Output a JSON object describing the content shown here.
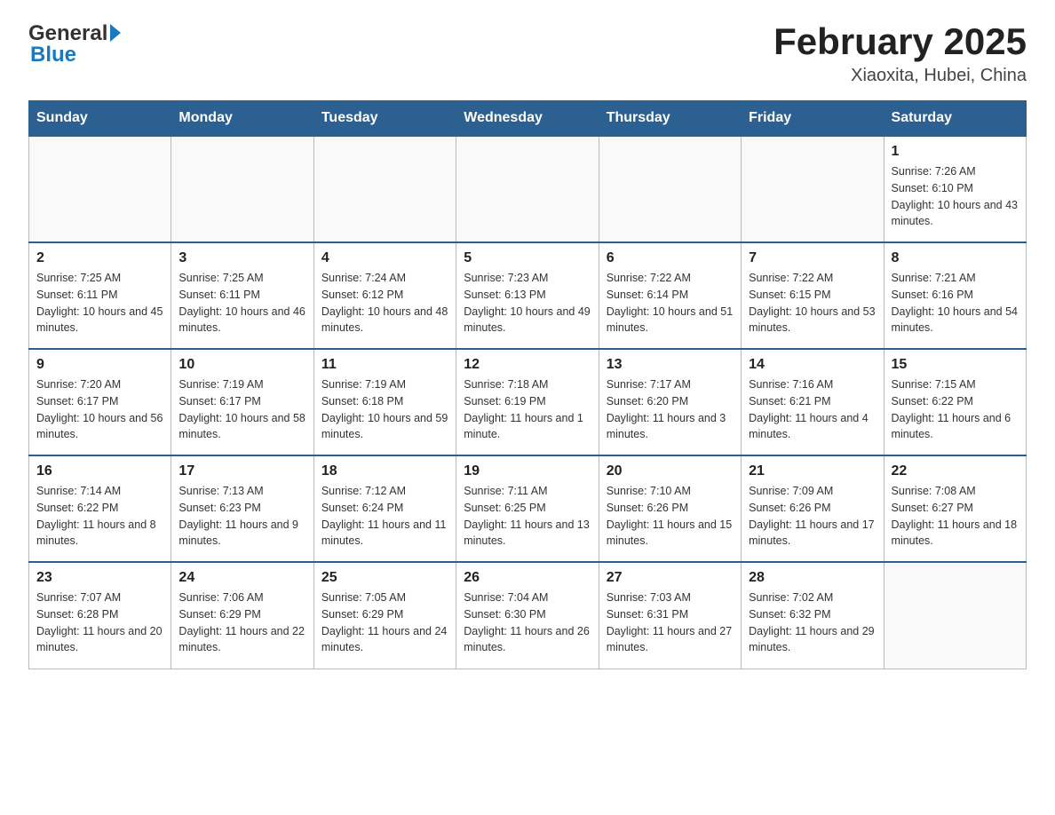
{
  "logo": {
    "general": "General",
    "blue": "Blue"
  },
  "header": {
    "month_year": "February 2025",
    "location": "Xiaoxita, Hubei, China"
  },
  "weekdays": [
    "Sunday",
    "Monday",
    "Tuesday",
    "Wednesday",
    "Thursday",
    "Friday",
    "Saturday"
  ],
  "weeks": [
    [
      {
        "day": "",
        "info": ""
      },
      {
        "day": "",
        "info": ""
      },
      {
        "day": "",
        "info": ""
      },
      {
        "day": "",
        "info": ""
      },
      {
        "day": "",
        "info": ""
      },
      {
        "day": "",
        "info": ""
      },
      {
        "day": "1",
        "info": "Sunrise: 7:26 AM\nSunset: 6:10 PM\nDaylight: 10 hours and 43 minutes."
      }
    ],
    [
      {
        "day": "2",
        "info": "Sunrise: 7:25 AM\nSunset: 6:11 PM\nDaylight: 10 hours and 45 minutes."
      },
      {
        "day": "3",
        "info": "Sunrise: 7:25 AM\nSunset: 6:11 PM\nDaylight: 10 hours and 46 minutes."
      },
      {
        "day": "4",
        "info": "Sunrise: 7:24 AM\nSunset: 6:12 PM\nDaylight: 10 hours and 48 minutes."
      },
      {
        "day": "5",
        "info": "Sunrise: 7:23 AM\nSunset: 6:13 PM\nDaylight: 10 hours and 49 minutes."
      },
      {
        "day": "6",
        "info": "Sunrise: 7:22 AM\nSunset: 6:14 PM\nDaylight: 10 hours and 51 minutes."
      },
      {
        "day": "7",
        "info": "Sunrise: 7:22 AM\nSunset: 6:15 PM\nDaylight: 10 hours and 53 minutes."
      },
      {
        "day": "8",
        "info": "Sunrise: 7:21 AM\nSunset: 6:16 PM\nDaylight: 10 hours and 54 minutes."
      }
    ],
    [
      {
        "day": "9",
        "info": "Sunrise: 7:20 AM\nSunset: 6:17 PM\nDaylight: 10 hours and 56 minutes."
      },
      {
        "day": "10",
        "info": "Sunrise: 7:19 AM\nSunset: 6:17 PM\nDaylight: 10 hours and 58 minutes."
      },
      {
        "day": "11",
        "info": "Sunrise: 7:19 AM\nSunset: 6:18 PM\nDaylight: 10 hours and 59 minutes."
      },
      {
        "day": "12",
        "info": "Sunrise: 7:18 AM\nSunset: 6:19 PM\nDaylight: 11 hours and 1 minute."
      },
      {
        "day": "13",
        "info": "Sunrise: 7:17 AM\nSunset: 6:20 PM\nDaylight: 11 hours and 3 minutes."
      },
      {
        "day": "14",
        "info": "Sunrise: 7:16 AM\nSunset: 6:21 PM\nDaylight: 11 hours and 4 minutes."
      },
      {
        "day": "15",
        "info": "Sunrise: 7:15 AM\nSunset: 6:22 PM\nDaylight: 11 hours and 6 minutes."
      }
    ],
    [
      {
        "day": "16",
        "info": "Sunrise: 7:14 AM\nSunset: 6:22 PM\nDaylight: 11 hours and 8 minutes."
      },
      {
        "day": "17",
        "info": "Sunrise: 7:13 AM\nSunset: 6:23 PM\nDaylight: 11 hours and 9 minutes."
      },
      {
        "day": "18",
        "info": "Sunrise: 7:12 AM\nSunset: 6:24 PM\nDaylight: 11 hours and 11 minutes."
      },
      {
        "day": "19",
        "info": "Sunrise: 7:11 AM\nSunset: 6:25 PM\nDaylight: 11 hours and 13 minutes."
      },
      {
        "day": "20",
        "info": "Sunrise: 7:10 AM\nSunset: 6:26 PM\nDaylight: 11 hours and 15 minutes."
      },
      {
        "day": "21",
        "info": "Sunrise: 7:09 AM\nSunset: 6:26 PM\nDaylight: 11 hours and 17 minutes."
      },
      {
        "day": "22",
        "info": "Sunrise: 7:08 AM\nSunset: 6:27 PM\nDaylight: 11 hours and 18 minutes."
      }
    ],
    [
      {
        "day": "23",
        "info": "Sunrise: 7:07 AM\nSunset: 6:28 PM\nDaylight: 11 hours and 20 minutes."
      },
      {
        "day": "24",
        "info": "Sunrise: 7:06 AM\nSunset: 6:29 PM\nDaylight: 11 hours and 22 minutes."
      },
      {
        "day": "25",
        "info": "Sunrise: 7:05 AM\nSunset: 6:29 PM\nDaylight: 11 hours and 24 minutes."
      },
      {
        "day": "26",
        "info": "Sunrise: 7:04 AM\nSunset: 6:30 PM\nDaylight: 11 hours and 26 minutes."
      },
      {
        "day": "27",
        "info": "Sunrise: 7:03 AM\nSunset: 6:31 PM\nDaylight: 11 hours and 27 minutes."
      },
      {
        "day": "28",
        "info": "Sunrise: 7:02 AM\nSunset: 6:32 PM\nDaylight: 11 hours and 29 minutes."
      },
      {
        "day": "",
        "info": ""
      }
    ]
  ]
}
